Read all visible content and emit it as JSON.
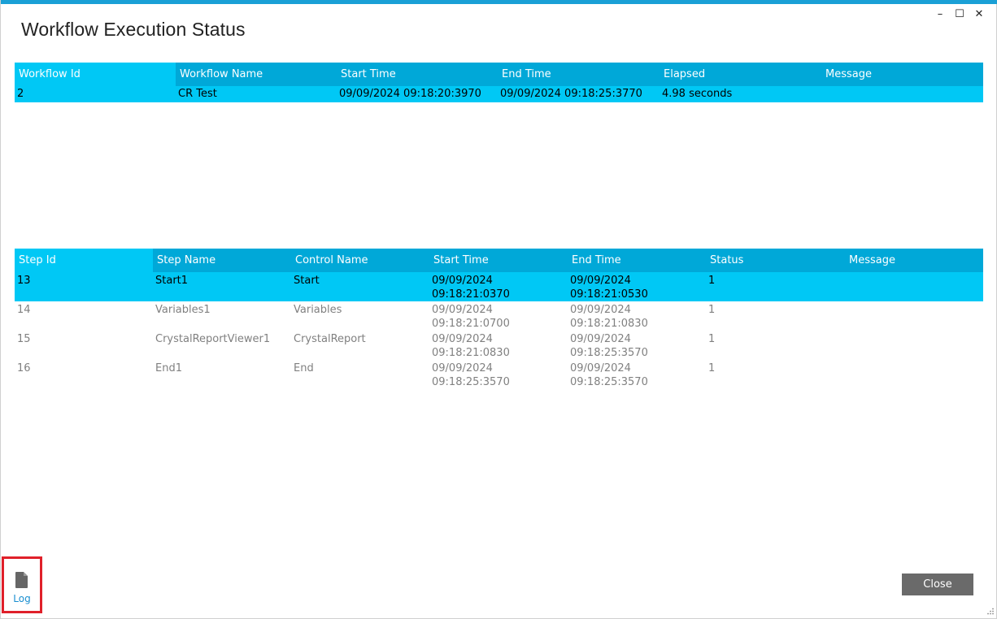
{
  "window": {
    "title": "Workflow Execution Status",
    "controls": {
      "minimize": "–",
      "maximize": "☐",
      "close": "✕"
    }
  },
  "workflow_grid": {
    "columns": [
      "Workflow Id",
      "Workflow Name",
      "Start Time",
      "End Time",
      "Elapsed",
      "Message"
    ],
    "rows": [
      [
        "2",
        "CR Test",
        "09/09/2024 09:18:20:3970",
        "09/09/2024 09:18:25:3770",
        "4.98 seconds",
        ""
      ]
    ]
  },
  "steps_grid": {
    "columns": [
      "Step Id",
      "Step Name",
      "Control Name",
      "Start Time",
      "End Time",
      "Status",
      "Message"
    ],
    "rows": [
      [
        "13",
        "Start1",
        "Start",
        "09/09/2024\n09:18:21:0370",
        "09/09/2024\n09:18:21:0530",
        "1",
        ""
      ],
      [
        "14",
        "Variables1",
        "Variables",
        "09/09/2024\n09:18:21:0700",
        "09/09/2024\n09:18:21:0830",
        "1",
        ""
      ],
      [
        "15",
        "CrystalReportViewer1",
        "CrystalReport",
        "09/09/2024\n09:18:21:0830",
        "09/09/2024\n09:18:25:3570",
        "1",
        ""
      ],
      [
        "16",
        "End1",
        "End",
        "09/09/2024\n09:18:25:3570",
        "09/09/2024\n09:18:25:3570",
        "1",
        ""
      ]
    ]
  },
  "footer": {
    "log_label": "Log",
    "log_icon": "document-icon",
    "close_label": "Close"
  },
  "colors": {
    "accent": "#1aa0d6",
    "header_bg": "#00a8d8",
    "selected_bg": "#00c8f5",
    "close_button": "#6a6a6a",
    "highlight_box": "#e0202a"
  }
}
